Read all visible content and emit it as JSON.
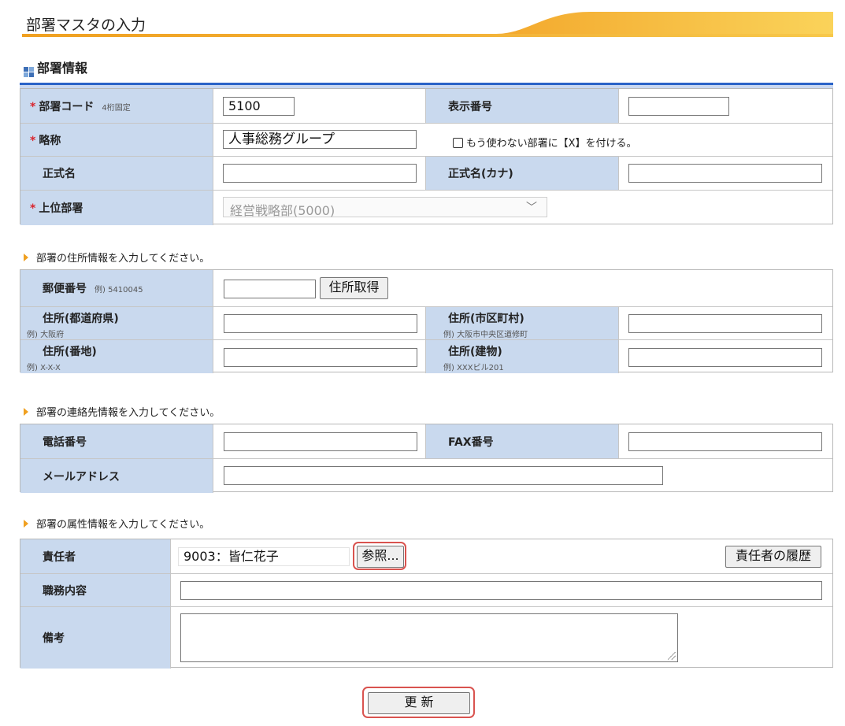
{
  "page": {
    "title": "部署マスタの入力"
  },
  "section": {
    "title": "部署情報"
  },
  "basic": {
    "dept_code": {
      "label": "部署コード",
      "hint": "4桁固定",
      "value": "5100"
    },
    "display_no": {
      "label": "表示番号",
      "value": ""
    },
    "abbr": {
      "label": "略称",
      "value": "人事総務グループ"
    },
    "unused_checkbox": {
      "label": "もう使わない部署に【X】を付ける。",
      "checked": false
    },
    "official_name": {
      "label": "正式名",
      "value": ""
    },
    "official_name_kana": {
      "label": "正式名(カナ)",
      "value": ""
    },
    "parent_dept": {
      "label": "上位部署",
      "value": "経営戦略部(5000)"
    },
    "required_mark": "*"
  },
  "address": {
    "note": "部署の住所情報を入力してください。",
    "postal": {
      "label": "郵便番号",
      "hint": "例) 5410045",
      "value": "",
      "button": "住所取得"
    },
    "prefecture": {
      "label": "住所(都道府県)",
      "hint": "例) 大阪府",
      "value": ""
    },
    "city": {
      "label": "住所(市区町村)",
      "hint": "例) 大阪市中央区道修町",
      "value": ""
    },
    "street": {
      "label": "住所(番地)",
      "hint": "例) X-X-X",
      "value": ""
    },
    "building": {
      "label": "住所(建物)",
      "hint": "例) XXXビル201",
      "value": ""
    }
  },
  "contact": {
    "note": "部署の連絡先情報を入力してください。",
    "phone": {
      "label": "電話番号",
      "value": ""
    },
    "fax": {
      "label": "FAX番号",
      "value": ""
    },
    "email": {
      "label": "メールアドレス",
      "value": ""
    }
  },
  "attributes": {
    "note": "部署の属性情報を入力してください。",
    "manager": {
      "label": "責任者",
      "value": "9003：皆仁花子",
      "ref_button": "参照...",
      "history_button": "責任者の履歴"
    },
    "duties": {
      "label": "職務内容",
      "value": ""
    },
    "remarks": {
      "label": "備考",
      "value": ""
    }
  },
  "actions": {
    "update": "更 新"
  },
  "colors": {
    "label_bg": "#c9d9ee",
    "accent_orange": "#f0a020",
    "header_blue": "#2a63c8",
    "required": "#d9262e",
    "highlight": "#d9534f"
  }
}
